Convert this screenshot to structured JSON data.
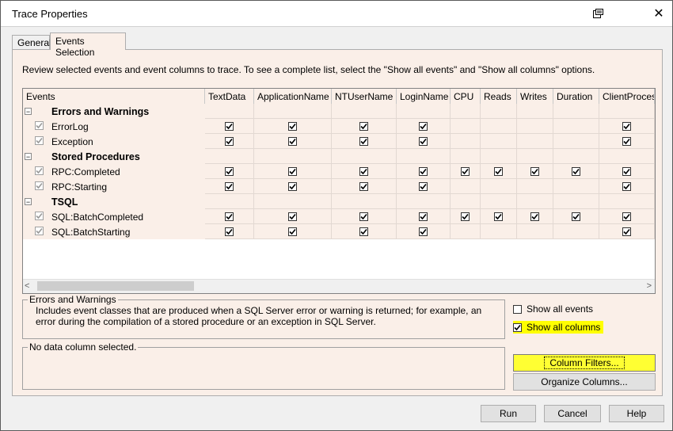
{
  "window": {
    "title": "Trace Properties"
  },
  "tabs": [
    {
      "label": "General",
      "active": false
    },
    {
      "label": "Events Selection",
      "active": true
    }
  ],
  "instructions": "Review selected events and event columns to trace. To see a complete list, select the \"Show all events\" and \"Show all columns\" options.",
  "grid": {
    "columns": [
      "Events",
      "TextData",
      "ApplicationName",
      "NTUserName",
      "LoginName",
      "CPU",
      "Reads",
      "Writes",
      "Duration",
      "ClientProcessI"
    ],
    "categories": [
      {
        "name": "Errors and Warnings",
        "events": [
          {
            "name": "ErrorLog",
            "checks": [
              true,
              true,
              true,
              true,
              false,
              false,
              false,
              false,
              true
            ]
          },
          {
            "name": "Exception",
            "checks": [
              true,
              true,
              true,
              true,
              false,
              false,
              false,
              false,
              true
            ]
          }
        ]
      },
      {
        "name": "Stored Procedures",
        "events": [
          {
            "name": "RPC:Completed",
            "checks": [
              true,
              true,
              true,
              true,
              true,
              true,
              true,
              true,
              true
            ]
          },
          {
            "name": "RPC:Starting",
            "checks": [
              true,
              true,
              true,
              true,
              false,
              false,
              false,
              false,
              true
            ]
          }
        ]
      },
      {
        "name": "TSQL",
        "events": [
          {
            "name": "SQL:BatchCompleted",
            "checks": [
              true,
              true,
              true,
              true,
              true,
              true,
              true,
              true,
              true
            ]
          },
          {
            "name": "SQL:BatchStarting",
            "checks": [
              true,
              true,
              true,
              true,
              false,
              false,
              false,
              false,
              true
            ]
          }
        ]
      }
    ]
  },
  "description": {
    "title": "Errors and Warnings",
    "text": "Includes event classes that are produced when a SQL Server error or warning is returned; for example, an error during the compilation of a stored procedure or an exception in SQL Server."
  },
  "column_info": "No data column selected.",
  "options": {
    "show_all_events": {
      "label": "Show all events",
      "checked": false
    },
    "show_all_columns": {
      "label": "Show all columns",
      "checked": true
    }
  },
  "buttons": {
    "column_filters": "Column Filters...",
    "organize_columns": "Organize Columns...",
    "run": "Run",
    "cancel": "Cancel",
    "help": "Help"
  },
  "colors": {
    "panel": "#faefe8",
    "highlight": "#ffff00"
  }
}
